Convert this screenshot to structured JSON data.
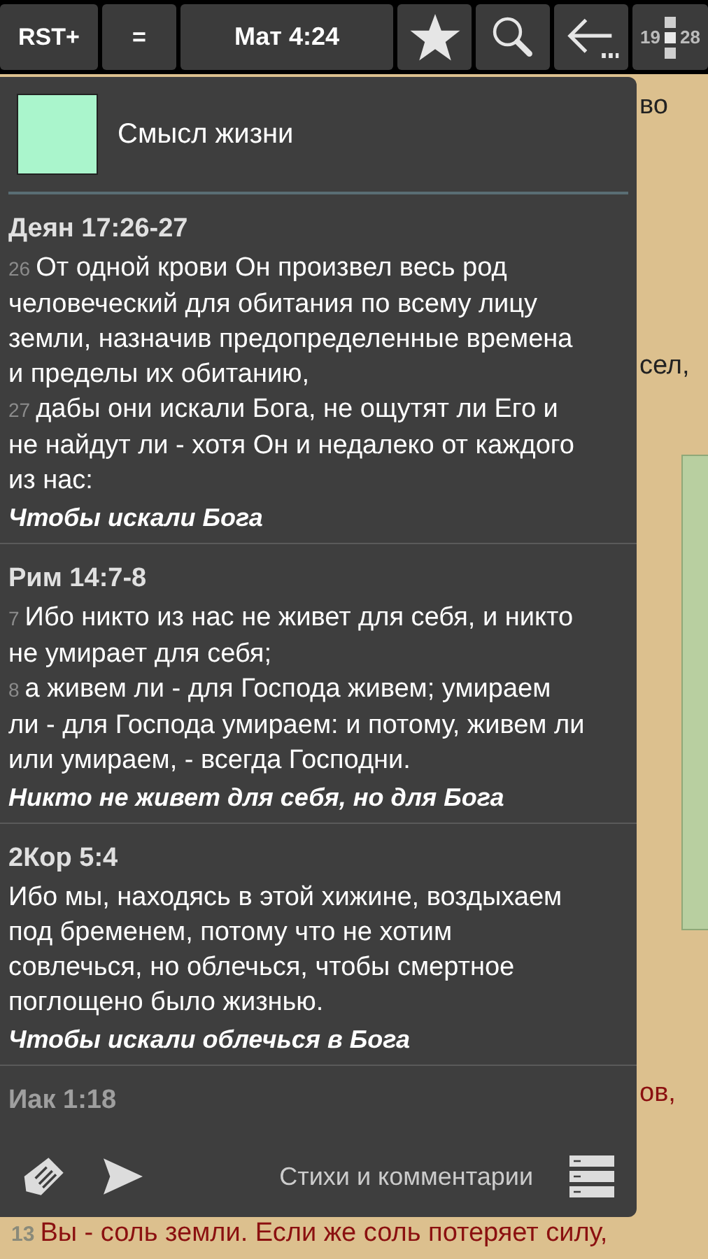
{
  "toolbar": {
    "translation": "RST+",
    "menu": "=",
    "reference": "Мат 4:24",
    "page_from": "19",
    "page_to": "28"
  },
  "background": {
    "fragments": [
      {
        "text": "во",
        "kind": "plain"
      },
      {
        "text": "сел,",
        "kind": "plain"
      },
      {
        "text": "ов,",
        "kind": "red"
      }
    ],
    "verse_number": "13",
    "verse_text": "Вы - соль земли. Если же соль потеряет силу,"
  },
  "popup": {
    "title": "Смысл жизни",
    "color": "#aaf5cc",
    "entries": [
      {
        "reference": "Деян 17:26-27",
        "faded": false,
        "verses": [
          {
            "number": "26",
            "text": "От одной крови Он произвел весь род человеческий для обитания по всему лицу земли, назначив предопределенные времена и пределы их обитанию,"
          },
          {
            "number": "27",
            "text": "дабы они искали Бога, не ощутят ли Его и не найдут ли - хотя Он и недалеко от каждого из нас:"
          }
        ],
        "comment": "Чтобы искали Бога"
      },
      {
        "reference": "Рим 14:7-8",
        "faded": false,
        "verses": [
          {
            "number": "7",
            "text": "Ибо никто из нас не живет для себя, и никто не умирает для себя;"
          },
          {
            "number": "8",
            "text": "а живем ли - для Господа живем; умираем ли - для Господа умираем: и потому, живем ли или умираем, - всегда Господни."
          }
        ],
        "comment": "Никто не живет для себя, но для Бога"
      },
      {
        "reference": "2Кор 5:4",
        "faded": false,
        "verses": [
          {
            "text": "Ибо мы, находясь в этой хижине, воздыхаем под бременем, потому что не хотим совлечься, но облечься, чтобы смертное поглощено было жизнью."
          }
        ],
        "comment": "Чтобы искали облечься в Бога"
      },
      {
        "reference": "Иак 1:18",
        "faded": true
      }
    ],
    "footer_label": "Стихи и комментарии"
  }
}
